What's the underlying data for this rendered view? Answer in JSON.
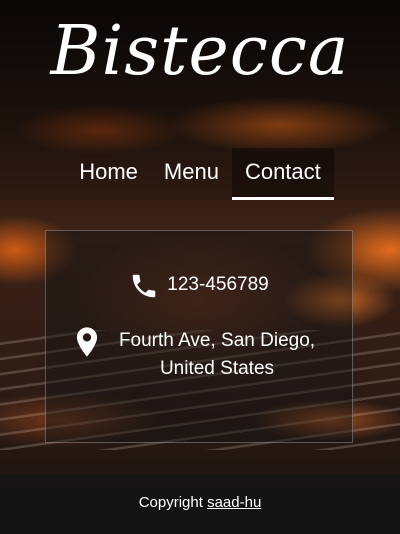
{
  "brand": {
    "name": "Bistecca"
  },
  "nav": {
    "items": [
      {
        "label": "Home"
      },
      {
        "label": "Menu"
      },
      {
        "label": "Contact"
      }
    ],
    "active": "Contact"
  },
  "contact": {
    "phone": "123-456789",
    "address": "Fourth Ave, San Diego, United States",
    "phone_icon": "phone-icon",
    "address_icon": "map-pin-icon"
  },
  "footer": {
    "prefix": "Copyright",
    "link_text": "saad-hu"
  },
  "colors": {
    "text": "#ffffff",
    "footer_bg": "#141414"
  }
}
